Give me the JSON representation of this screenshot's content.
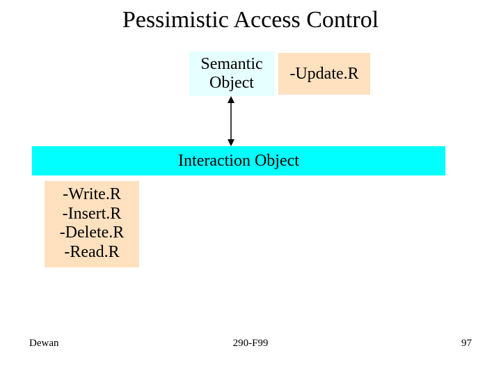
{
  "title": "Pessimistic Access Control",
  "semantic_box": "Semantic\nObject",
  "update_box": "-Update.R",
  "interaction_box": "Interaction Object",
  "ops": [
    "-Write.R",
    "-Insert.R",
    "-Delete.R",
    "-Read.R"
  ],
  "footer": {
    "left": "Dewan",
    "center": "290-F99",
    "right": "97"
  }
}
